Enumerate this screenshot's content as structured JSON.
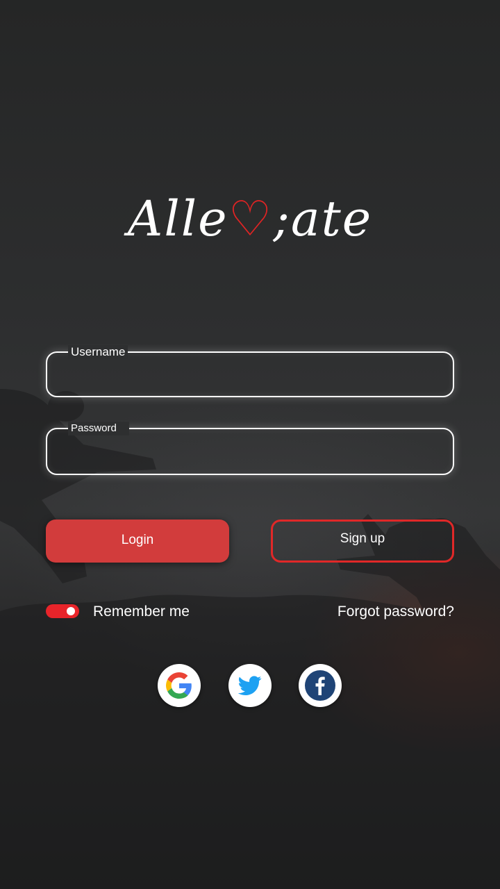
{
  "app": {
    "logo_text_start": "Alle",
    "logo_text_heart": "♡",
    "logo_text_end": ";ate"
  },
  "form": {
    "username": {
      "label": "Username",
      "value": "",
      "placeholder": ""
    },
    "password": {
      "label": "Password",
      "value": "",
      "placeholder": ""
    }
  },
  "buttons": {
    "login": "Login",
    "signup": "Sign up"
  },
  "options": {
    "remember_me": "Remember me",
    "remember_me_on": true,
    "forgot_password": "Forgot password?"
  },
  "social": [
    {
      "name": "google",
      "icon": "google-icon"
    },
    {
      "name": "twitter",
      "icon": "twitter-icon"
    },
    {
      "name": "facebook",
      "icon": "facebook-icon"
    }
  ],
  "colors": {
    "accent": "#e02424",
    "login_bg": "#d23c3c",
    "facebook": "#1f4476",
    "twitter": "#1da1f2"
  }
}
